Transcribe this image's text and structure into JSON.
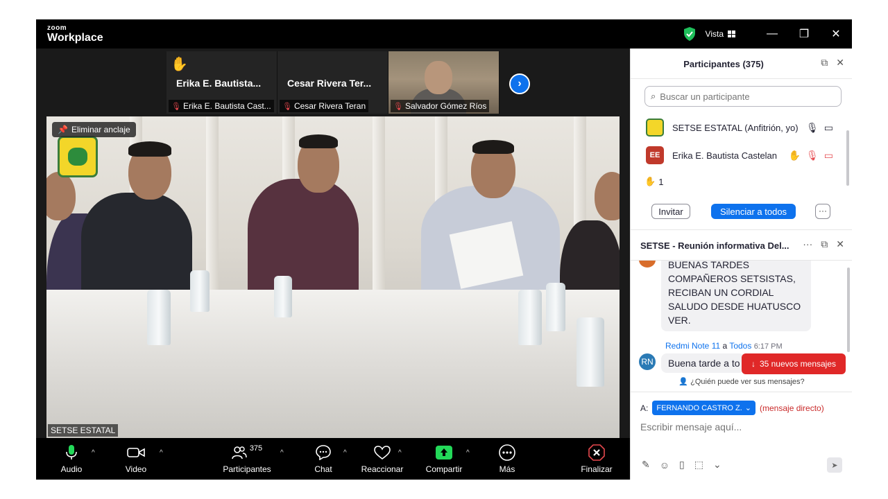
{
  "app": {
    "brand_small": "zoom",
    "brand_big": "Workplace",
    "view_label": "Vista",
    "minimize": "—",
    "restore": "❐",
    "close": "✕"
  },
  "strip": {
    "tiles": [
      {
        "name": "Erika E. Bautista...",
        "label": "Erika E. Bautista Cast..."
      },
      {
        "name": "Cesar Rivera Ter...",
        "label": "Cesar Rivera Teran"
      },
      {
        "label": "Salvador Gómez Ríos"
      }
    ],
    "next": "›"
  },
  "main_video": {
    "unpin_label": "Eliminar anclaje",
    "name_label": "SETSE ESTATAL"
  },
  "toolbar": {
    "audio": "Audio",
    "video": "Video",
    "participants": "Participantes",
    "participants_count": "375",
    "chat": "Chat",
    "react": "Reaccionar",
    "share": "Compartir",
    "more": "Más",
    "end": "Finalizar"
  },
  "participants_panel": {
    "title": "Participantes (375)",
    "search_placeholder": "Buscar un participante",
    "rows": [
      {
        "name": "SETSE ESTATAL (Anfitrión, yo)"
      },
      {
        "initials": "EE",
        "name": "Erika E. Bautista Castelan"
      }
    ],
    "raised_hands": "1",
    "invite": "Invitar",
    "mute_all": "Silenciar a todos",
    "more": "···"
  },
  "chat_panel": {
    "title": "SETSE - Reunión informativa Del...",
    "more": "···",
    "message1": "BUENAS TARDES COMPAÑEROS SETSISTAS, RECIBAN UN CORDIAL SALUDO DESDE HUATUSCO VER.",
    "sender2": "Redmi Note 11",
    "to_word": "a",
    "to_target": "Todos",
    "time2": "6:17 PM",
    "initials2": "RN",
    "message2": "Buena tarde a to",
    "new_messages": "35 nuevos mensajes",
    "who_can_see": "¿Quién puede ver sus mensajes?",
    "to_label": "A:",
    "recipient": "FERNANDO CASTRO Z.",
    "dm_label": "(mensaje directo)",
    "compose_placeholder": "Escribir mensaje aquí..."
  },
  "colors": {
    "accent_blue": "#0e72ed",
    "danger_red": "#e02828",
    "share_green": "#23d959",
    "shield_green": "#1fbf5b"
  }
}
